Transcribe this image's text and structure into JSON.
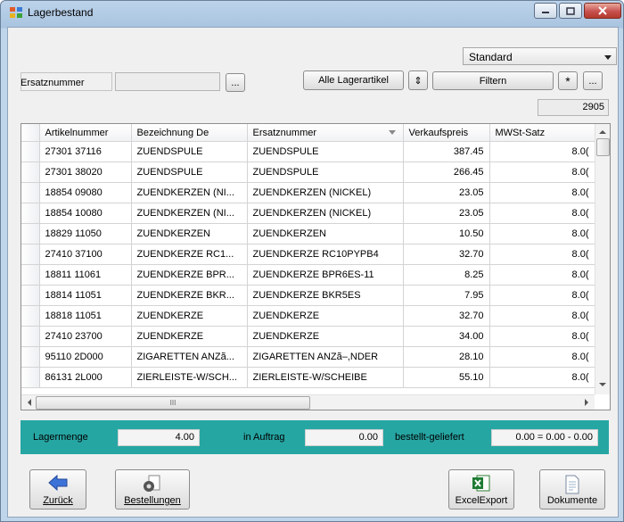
{
  "window": {
    "title": "Lagerbestand"
  },
  "toolbar": {
    "view_select": "Standard",
    "ersatz_label": "Ersatznummer",
    "ersatz_value": "",
    "browse_label": "...",
    "all_articles_label": "Alle Lagerartikel",
    "sort_label": "⇕",
    "filter_label": "Filtern",
    "star_label": "*",
    "more_label": "...",
    "count": "2905"
  },
  "grid": {
    "columns": [
      "Artikelnummer",
      "Bezeichnung De",
      "Ersatznummer",
      "Verkaufspreis",
      "MWSt-Satz"
    ],
    "rows": [
      [
        "27301 37116",
        "ZUENDSPULE",
        "ZUENDSPULE",
        "387.45",
        "8.0("
      ],
      [
        "27301 38020",
        "ZUENDSPULE",
        "ZUENDSPULE",
        "266.45",
        "8.0("
      ],
      [
        "18854 09080",
        "ZUENDKERZEN (NI...",
        "ZUENDKERZEN (NICKEL)",
        "23.05",
        "8.0("
      ],
      [
        "18854 10080",
        "ZUENDKERZEN (NI...",
        "ZUENDKERZEN (NICKEL)",
        "23.05",
        "8.0("
      ],
      [
        "18829 11050",
        "ZUENDKERZEN",
        "ZUENDKERZEN",
        "10.50",
        "8.0("
      ],
      [
        "27410 37100",
        "ZUENDKERZE RC1...",
        "ZUENDKERZE RC10PYPB4",
        "32.70",
        "8.0("
      ],
      [
        "18811 11061",
        "ZUENDKERZE BPR...",
        "ZUENDKERZE BPR6ES-11",
        "8.25",
        "8.0("
      ],
      [
        "18814 11051",
        "ZUENDKERZE BKR...",
        "ZUENDKERZE BKR5ES",
        "7.95",
        "8.0("
      ],
      [
        "18818 11051",
        "ZUENDKERZE",
        "ZUENDKERZE",
        "32.70",
        "8.0("
      ],
      [
        "27410 23700",
        "ZUENDKERZE",
        "ZUENDKERZE",
        "34.00",
        "8.0("
      ],
      [
        "95110 2D000",
        "ZIGARETTEN ANZã...",
        "ZIGARETTEN ANZã–,NDER",
        "28.10",
        "8.0("
      ],
      [
        "86131 2L000",
        "ZIERLEISTE-W/SCH...",
        "ZIERLEISTE-W/SCHEIBE",
        "55.10",
        "8.0("
      ]
    ],
    "hscroll_grip": "III"
  },
  "summary": {
    "lagermenge_label": "Lagermenge",
    "lagermenge_value": "4.00",
    "auftrag_label": "in Auftrag",
    "auftrag_value": "0.00",
    "bestellt_label": "bestellt-geliefert",
    "bestellt_value": "0.00 = 0.00 - 0.00"
  },
  "buttons": {
    "zurueck": "Zurück",
    "bestellungen": "Bestellungen",
    "excel": "ExcelExport",
    "dokumente": "Dokumente"
  },
  "colors": {
    "summary_bar": "#26a6a3",
    "title_gradient": "#a9c4e0"
  }
}
